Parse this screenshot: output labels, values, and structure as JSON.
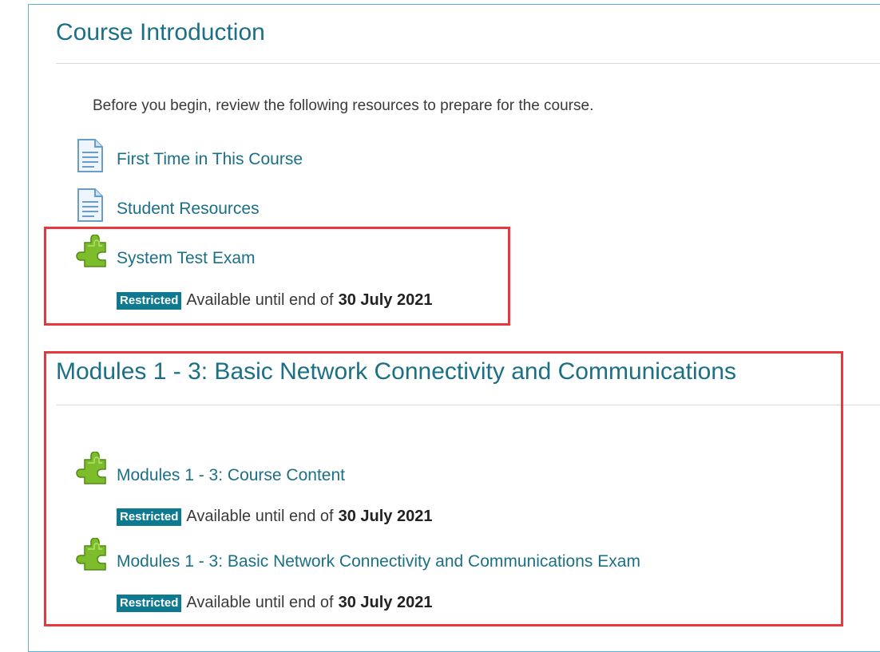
{
  "sections": [
    {
      "title": "Course Introduction",
      "intro": "Before you begin, review the following resources to prepare for the course.",
      "items": [
        {
          "type": "page",
          "label": "First Time in This Course"
        },
        {
          "type": "page",
          "label": "Student Resources"
        },
        {
          "type": "scorm",
          "label": "System Test Exam",
          "restriction": {
            "badge": "Restricted",
            "text": "Available until end of",
            "date": "30 July 2021"
          }
        }
      ]
    },
    {
      "title": "Modules 1 - 3: Basic Network Connectivity and Communications",
      "items": [
        {
          "type": "scorm",
          "label": "Modules 1 - 3: Course Content",
          "restriction": {
            "badge": "Restricted",
            "text": "Available until end of",
            "date": "30 July 2021"
          }
        },
        {
          "type": "scorm",
          "label": "Modules 1 - 3: Basic Network Connectivity and Communications Exam",
          "restriction": {
            "badge": "Restricted",
            "text": "Available until end of",
            "date": "30 July 2021"
          }
        }
      ]
    }
  ],
  "colors": {
    "link": "#1b6f86",
    "badge": "#0f7a8f",
    "highlight": "#e8383d",
    "frame": "#5bb3d8"
  },
  "icons": {
    "page": "document-icon",
    "scorm": "puzzle-icon"
  }
}
